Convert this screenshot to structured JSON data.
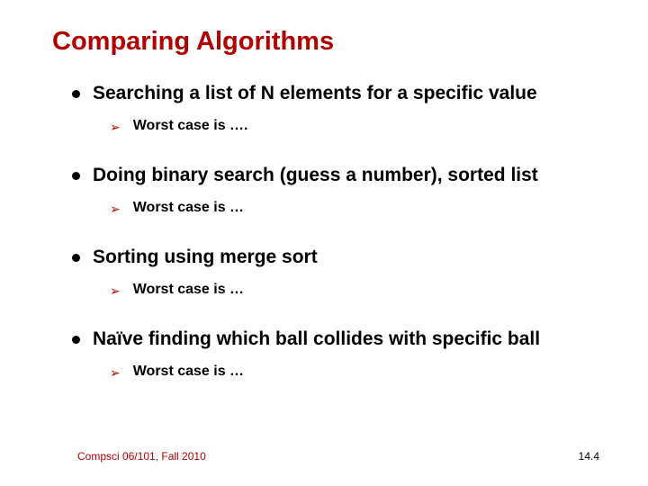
{
  "title": "Comparing Algorithms",
  "items": [
    {
      "heading": "Searching a list of N elements for a specific value",
      "sub": "Worst case is …."
    },
    {
      "heading": "Doing binary search (guess a number), sorted list",
      "sub": "Worst case is …"
    },
    {
      "heading": "Sorting using merge sort",
      "sub": "Worst case is …"
    },
    {
      "heading": "Naïve finding which ball collides with specific ball",
      "sub": "Worst case is …"
    }
  ],
  "footer": "Compsci 06/101, Fall 2010",
  "page": "14.4"
}
